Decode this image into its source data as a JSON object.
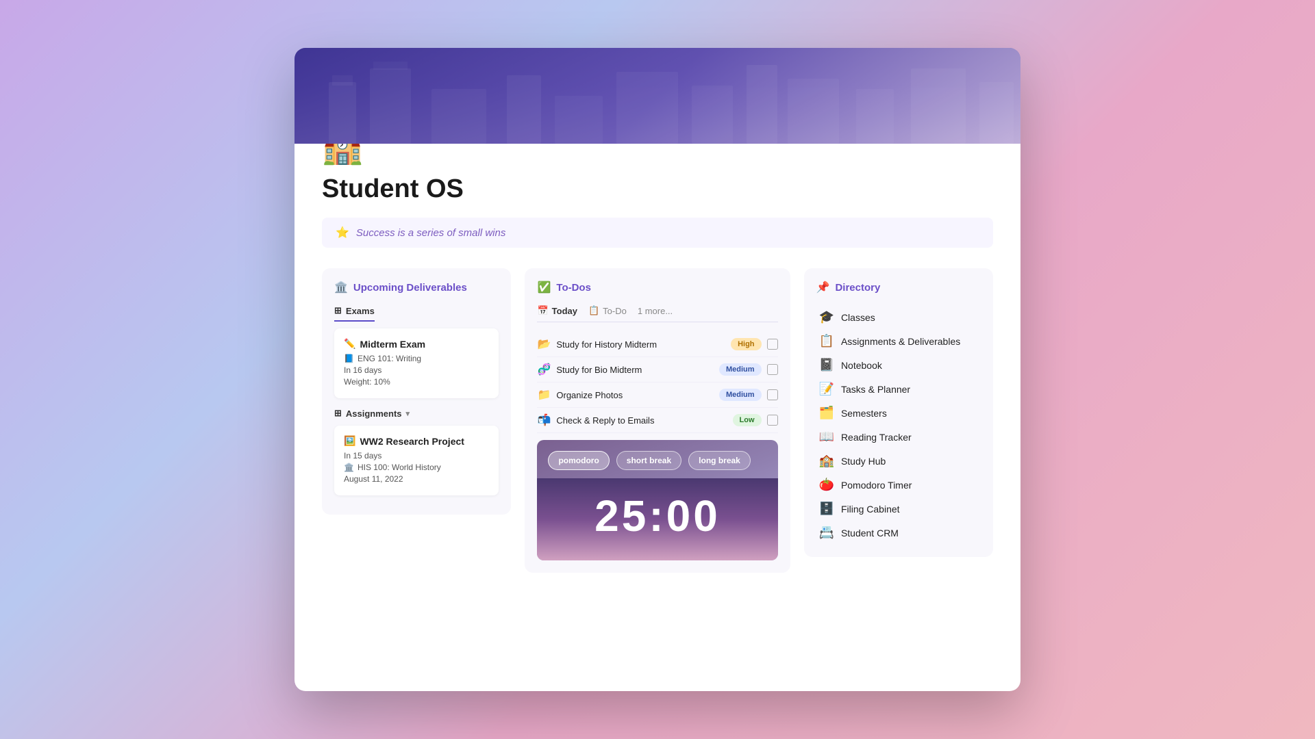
{
  "window": {
    "title": "Student OS"
  },
  "header": {
    "icon": "🏫",
    "title": "Student OS",
    "quote_icon": "⭐",
    "quote_text": "Success is a series of small wins"
  },
  "upcoming": {
    "section_title": "Upcoming Deliverables",
    "section_icon": "🏛️",
    "exams_label": "Exams",
    "exams": [
      {
        "icon": "✏️",
        "title": "Midterm Exam",
        "course_icon": "📘",
        "course": "ENG 101: Writing",
        "days": "In 16 days",
        "weight": "Weight: 10%"
      }
    ],
    "assignments_label": "Assignments",
    "assignments": [
      {
        "icon": "🖼️",
        "title": "WW2 Research Project",
        "days": "In 15 days",
        "course_icon": "🏛️",
        "course": "HIS 100: World History",
        "date": "August 11, 2022"
      }
    ]
  },
  "todos": {
    "section_title": "To-Dos",
    "section_icon": "✅",
    "tabs": [
      {
        "label": "Today",
        "icon": "📅",
        "active": true
      },
      {
        "label": "To-Do",
        "icon": "📋",
        "active": false
      },
      {
        "label": "1 more...",
        "active": false
      }
    ],
    "items": [
      {
        "icon": "📂",
        "label": "Study for History Midterm",
        "priority": "High",
        "priority_class": "badge-high"
      },
      {
        "icon": "🧬",
        "label": "Study for Bio Midterm",
        "priority": "Medium",
        "priority_class": "badge-medium"
      },
      {
        "icon": "📁",
        "label": "Organize Photos",
        "priority": "Medium",
        "priority_class": "badge-medium"
      },
      {
        "icon": "📬",
        "label": "Check & Reply to Emails",
        "priority": "Low",
        "priority_class": "badge-low"
      }
    ],
    "pomodoro": {
      "buttons": [
        "pomodoro",
        "short break",
        "long break"
      ],
      "time": "25:00"
    }
  },
  "directory": {
    "section_title": "Directory",
    "section_icon": "📌",
    "items": [
      {
        "icon": "🎓",
        "label": "Classes"
      },
      {
        "icon": "📋",
        "label": "Assignments & Deliverables"
      },
      {
        "icon": "📓",
        "label": "Notebook"
      },
      {
        "icon": "📝",
        "label": "Tasks & Planner"
      },
      {
        "icon": "🗂️",
        "label": "Semesters"
      },
      {
        "icon": "📖",
        "label": "Reading Tracker"
      },
      {
        "icon": "🏫",
        "label": "Study Hub"
      },
      {
        "icon": "🍅",
        "label": "Pomodoro Timer"
      },
      {
        "icon": "🗄️",
        "label": "Filing Cabinet"
      },
      {
        "icon": "📇",
        "label": "Student CRM"
      }
    ]
  }
}
